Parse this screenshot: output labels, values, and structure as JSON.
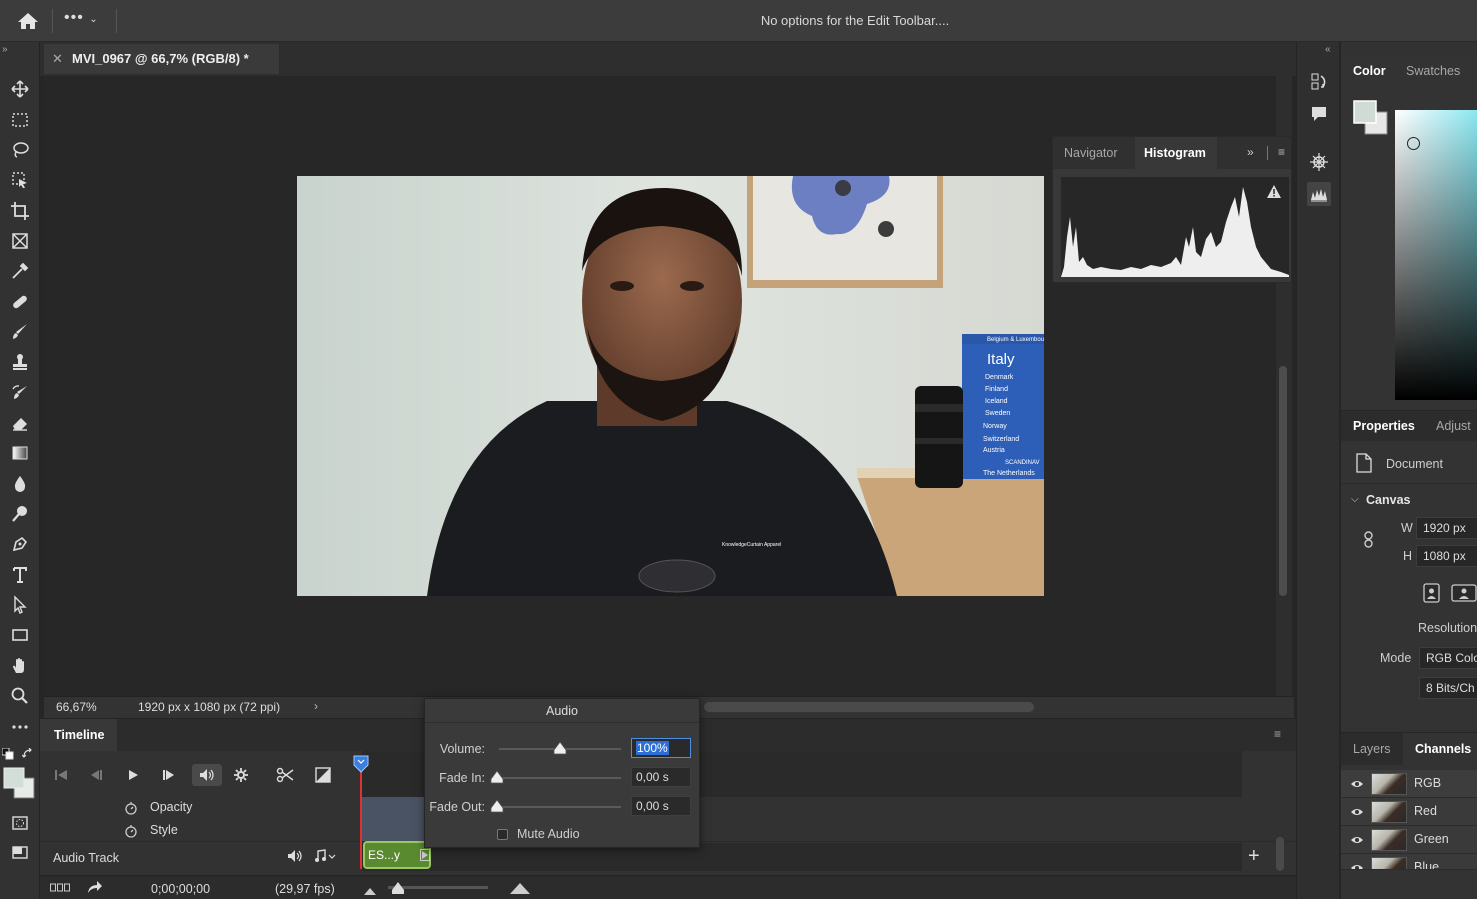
{
  "options_bar": {
    "home_icon": "home-icon",
    "more_label": "•••",
    "message": "No options for the Edit Toolbar...."
  },
  "document": {
    "tab_title": "MVI_0967 @ 66,7% (RGB/8) *",
    "zoom": "66,67%",
    "dimensions": "1920 px x 1080 px (72 ppi)"
  },
  "video_frame": {
    "book_titles": [
      "Belgium & Luxembourg",
      "Italy",
      "Denmark",
      "Finland",
      "Iceland",
      "Sweden",
      "Norway",
      "Switzerland",
      "Austria",
      "SCANDINAV",
      "The Netherlands"
    ],
    "shirt_logo": "KnowledgeCurtain Apparel"
  },
  "histogram_panel": {
    "tabs": [
      "Navigator",
      "Histogram"
    ],
    "active_tab": "Histogram"
  },
  "color_panel": {
    "tabs": [
      "Color",
      "Swatches"
    ],
    "active_tab": "Color"
  },
  "properties_panel": {
    "tabs": [
      "Properties",
      "Adjust"
    ],
    "active_tab": "Properties",
    "doc_label": "Document",
    "canvas_section": "Canvas",
    "w_label": "W",
    "w_value": "1920 px",
    "h_label": "H",
    "h_value": "1080 px",
    "resolution_label": "Resolution",
    "mode_label": "Mode",
    "mode_value": "RGB Colo",
    "bits_value": "8 Bits/Ch"
  },
  "layers_panel": {
    "tabs": [
      "Layers",
      "Channels"
    ],
    "active_tab": "Channels",
    "channels": [
      "RGB",
      "Red",
      "Green",
      "Blue"
    ]
  },
  "timeline": {
    "title": "Timeline",
    "tracks": [
      "Opacity",
      "Style"
    ],
    "audio_track_label": "Audio Track",
    "audio_clip_label": "ES...y",
    "timecode": "0;00;00;00",
    "fps": "(29,97 fps)"
  },
  "audio_popup": {
    "title": "Audio",
    "volume_label": "Volume:",
    "volume_value": "100%",
    "volume_level": 0.5,
    "fade_in_label": "Fade In:",
    "fade_in_value": "0,00 s",
    "fade_out_label": "Fade Out:",
    "fade_out_value": "0,00 s",
    "mute_label": "Mute Audio",
    "mute_checked": false
  }
}
